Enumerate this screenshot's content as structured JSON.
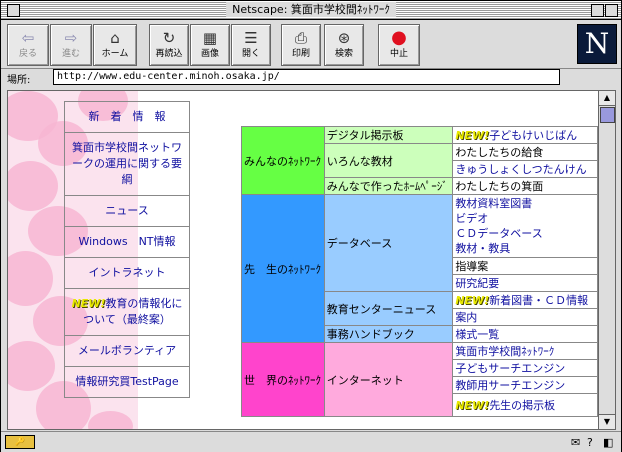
{
  "window": {
    "title": "Netscape: 箕面市学校間ﾈｯﾄﾜｰｸ"
  },
  "toolbar": {
    "back": "戻る",
    "forward": "進む",
    "home": "ホーム",
    "reload": "再読込",
    "images": "画像",
    "open": "開く",
    "print": "印刷",
    "find": "検索",
    "stop": "中止"
  },
  "location": {
    "label": "場所:",
    "url": "http://www.edu-center.minoh.osaka.jp/"
  },
  "sidebar": {
    "items": [
      {
        "label": "新　着　情　報"
      },
      {
        "label": "箕面市学校間ネットワークの運用に関する要綱"
      },
      {
        "label": "ニュース"
      },
      {
        "label": "Windows　NT情報"
      },
      {
        "label": "イントラネット"
      },
      {
        "badge": "NEW!",
        "label": "教育の情報化について（最終案）"
      },
      {
        "label": "メールボランティア"
      },
      {
        "label": "情報研究買TestPage"
      }
    ]
  },
  "directory": {
    "group1": {
      "name": "みんなのﾈｯﾄﾜｰｸ",
      "sub1": "デジタル掲示板",
      "sub1_link_badge": "NEW!",
      "sub1_link": "子どもけいじばん",
      "sub2": "いろんな教材",
      "sub2_link1": "わたしたちの給食",
      "sub2_link2": "きゅうしょくしつたんけん",
      "sub3": "みんなで作ったﾎｰﾑﾍﾟｰｼﾞ",
      "sub3_link": "わたしたちの箕面"
    },
    "group2": {
      "name": "先　生のﾈｯﾄﾜｰｸ",
      "sub1": "データベース",
      "sub1_links": [
        "教材資料室図書",
        "ビデオ",
        "ＣＤデータベース",
        "教材・教具"
      ],
      "sub1_link2": "指導案",
      "sub1_link3": "研究紀要",
      "sub2": "教育センターニュース",
      "sub2_badge": "NEW!",
      "sub2_link1": "新着図書・ＣＤ情報",
      "sub2_link2": "案内",
      "sub3": "事務ハンドブック",
      "sub3_link": "様式一覧"
    },
    "group3": {
      "name": "世　界のﾈｯﾄﾜｰｸ",
      "sub1": "インターネット",
      "links": [
        "箕面市学校間ﾈｯﾄﾜｰｸ",
        "子どもサーチエンジン",
        "教師用サーチエンジン"
      ],
      "last_badge": "NEW!",
      "last_link": "先生の掲示板"
    }
  },
  "colors": {
    "green": "#66ff44",
    "blue": "#3399ff",
    "pink": "#ff44cc",
    "link": "#1010a0"
  }
}
